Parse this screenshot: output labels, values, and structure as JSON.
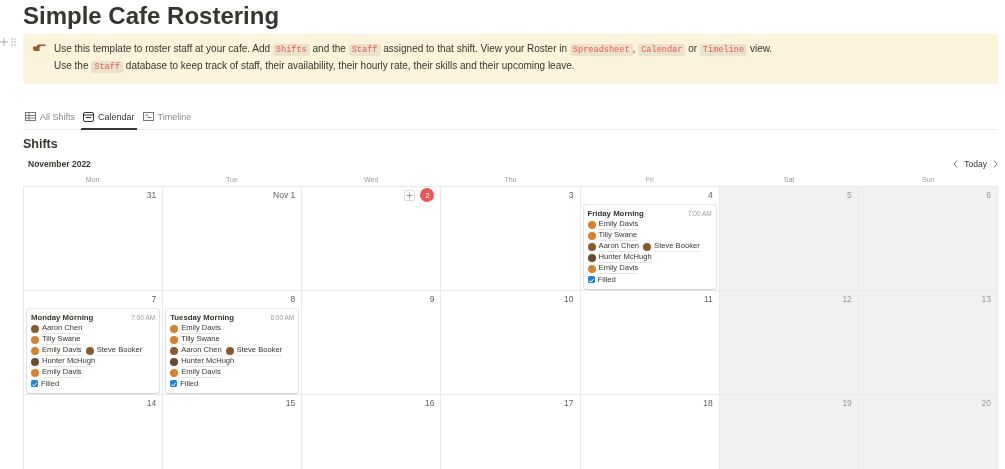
{
  "page": {
    "title": "Simple Cafe Rostering"
  },
  "callout": {
    "lines": [
      [
        {
          "text": "Use this template to roster staff at your cafe. Add ",
          "code": false
        },
        {
          "text": "Shifts",
          "code": true
        },
        {
          "text": " and the ",
          "code": false
        },
        {
          "text": "Staff",
          "code": true
        },
        {
          "text": " assigned to that shift. View your Roster in ",
          "code": false
        },
        {
          "text": "Spreadsheet",
          "code": true
        },
        {
          "text": ", ",
          "code": false
        },
        {
          "text": "Calendar",
          "code": true
        },
        {
          "text": " or ",
          "code": false
        },
        {
          "text": "Timeline",
          "code": true
        },
        {
          "text": " view.",
          "code": false
        }
      ],
      [
        {
          "text": "Use the ",
          "code": false
        },
        {
          "text": "Staff",
          "code": true
        },
        {
          "text": " database to keep track of staff, their availability, their hourly rate, their skills and their upcoming leave.",
          "code": false
        }
      ]
    ]
  },
  "tabs": [
    {
      "label": "All Shifts",
      "kind": "table",
      "selected": false
    },
    {
      "label": "Calendar",
      "kind": "calendar",
      "selected": true
    },
    {
      "label": "Timeline",
      "kind": "timeline",
      "selected": false
    }
  ],
  "database_title": "Shifts",
  "calendar": {
    "month": "November 2022",
    "today_button": "Today",
    "weekdays": [
      "Mon",
      "Tue",
      "Wed",
      "Thu",
      "Fri",
      "Sat",
      "Sun"
    ],
    "weeks": [
      [
        {
          "label": "31",
          "today": false,
          "weekend": false
        },
        {
          "label": "Nov 1",
          "today": false,
          "weekend": false
        },
        {
          "label": "2",
          "today": true,
          "weekend": false
        },
        {
          "label": "3",
          "today": false,
          "weekend": false
        },
        {
          "label": "4",
          "today": false,
          "weekend": false,
          "events": [
            {
              "title": "Friday Morning",
              "time": "7:00 AM",
              "staff_lines": [
                [
                  "Emily Davis"
                ],
                [
                  "Tilly Swane"
                ],
                [
                  "Aaron Chen",
                  "Steve Booker"
                ],
                [
                  "Hunter McHugh"
                ],
                [
                  "Emily Davis"
                ]
              ],
              "filled_label": "Filled",
              "filled": true
            }
          ]
        },
        {
          "label": "5",
          "today": false,
          "weekend": true
        },
        {
          "label": "6",
          "today": false,
          "weekend": true
        }
      ],
      [
        {
          "label": "7",
          "today": false,
          "weekend": false,
          "events": [
            {
              "title": "Monday Morning",
              "time": "7:00 AM",
              "staff_lines": [
                [
                  "Aaron Chen"
                ],
                [
                  "Tilly Swane"
                ],
                [
                  "Emily Davis",
                  "Steve Booker"
                ],
                [
                  "Hunter McHugh"
                ],
                [
                  "Emily Davis"
                ]
              ],
              "filled_label": "Filled",
              "filled": true
            }
          ]
        },
        {
          "label": "8",
          "today": false,
          "weekend": false,
          "events": [
            {
              "title": "Tuesday Morning",
              "time": "6:00 AM",
              "staff_lines": [
                [
                  "Emily Davis"
                ],
                [
                  "Tilly Swane"
                ],
                [
                  "Aaron Chen",
                  "Steve Booker"
                ],
                [
                  "Hunter McHugh"
                ],
                [
                  "Emily Davis"
                ]
              ],
              "filled_label": "Filled",
              "filled": true
            }
          ]
        },
        {
          "label": "9",
          "today": false,
          "weekend": false
        },
        {
          "label": "10",
          "today": false,
          "weekend": false
        },
        {
          "label": "11",
          "today": false,
          "weekend": false
        },
        {
          "label": "12",
          "today": false,
          "weekend": true
        },
        {
          "label": "13",
          "today": false,
          "weekend": true
        }
      ],
      [
        {
          "label": "14",
          "today": false,
          "weekend": false
        },
        {
          "label": "15",
          "today": false,
          "weekend": false
        },
        {
          "label": "16",
          "today": false,
          "weekend": false
        },
        {
          "label": "17",
          "today": false,
          "weekend": false
        },
        {
          "label": "18",
          "today": false,
          "weekend": false
        },
        {
          "label": "19",
          "today": false,
          "weekend": true
        },
        {
          "label": "20",
          "today": false,
          "weekend": true
        }
      ]
    ]
  }
}
